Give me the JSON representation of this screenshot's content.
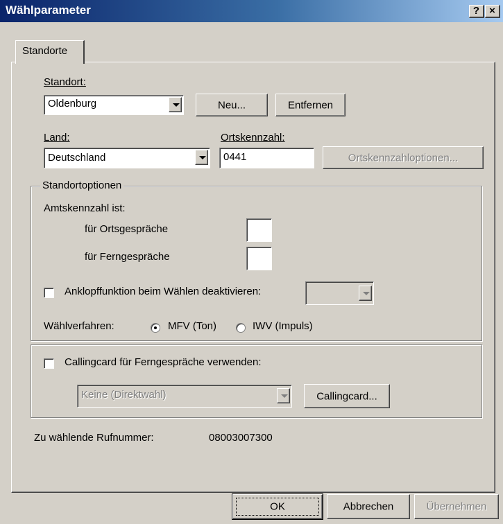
{
  "window": {
    "title": "Wählparameter",
    "help_label": "?",
    "close_label": "×"
  },
  "tabs": [
    {
      "label": "Standorte"
    }
  ],
  "standort": {
    "label": "Standort:",
    "value": "Oldenburg",
    "new_button": "Neu...",
    "remove_button": "Entfernen"
  },
  "land": {
    "label": "Land:",
    "value": "Deutschland"
  },
  "ortskennzahl": {
    "label": "Ortskennzahl:",
    "value": "0441",
    "options_button": "Ortskennzahloptionen..."
  },
  "standortoptionen": {
    "title": "Standortoptionen",
    "amtskennzahl_label": "Amtskennzahl ist:",
    "local_label": "für Ortsgespräche",
    "local_value": "",
    "long_distance_label": "für Ferngespräche",
    "long_distance_value": "",
    "call_waiting_label": "Anklopffunktion beim Wählen deaktivieren:",
    "call_waiting_checked": false,
    "dial_mode_label": "Wählverfahren:",
    "tone_label": "MFV (Ton)",
    "tone_selected": true,
    "pulse_label": "IWV (Impuls)",
    "pulse_selected": false,
    "callingcard_label": "Callingcard für Ferngespräche verwenden:",
    "callingcard_checked": false,
    "callingcard_value": "Keine (Direktwahl)",
    "callingcard_button": "Callingcard..."
  },
  "dial_number": {
    "label": "Zu wählende Rufnummer:",
    "value": "08003007300"
  },
  "buttons": {
    "ok": "OK",
    "cancel": "Abbrechen",
    "apply": "Übernehmen"
  }
}
